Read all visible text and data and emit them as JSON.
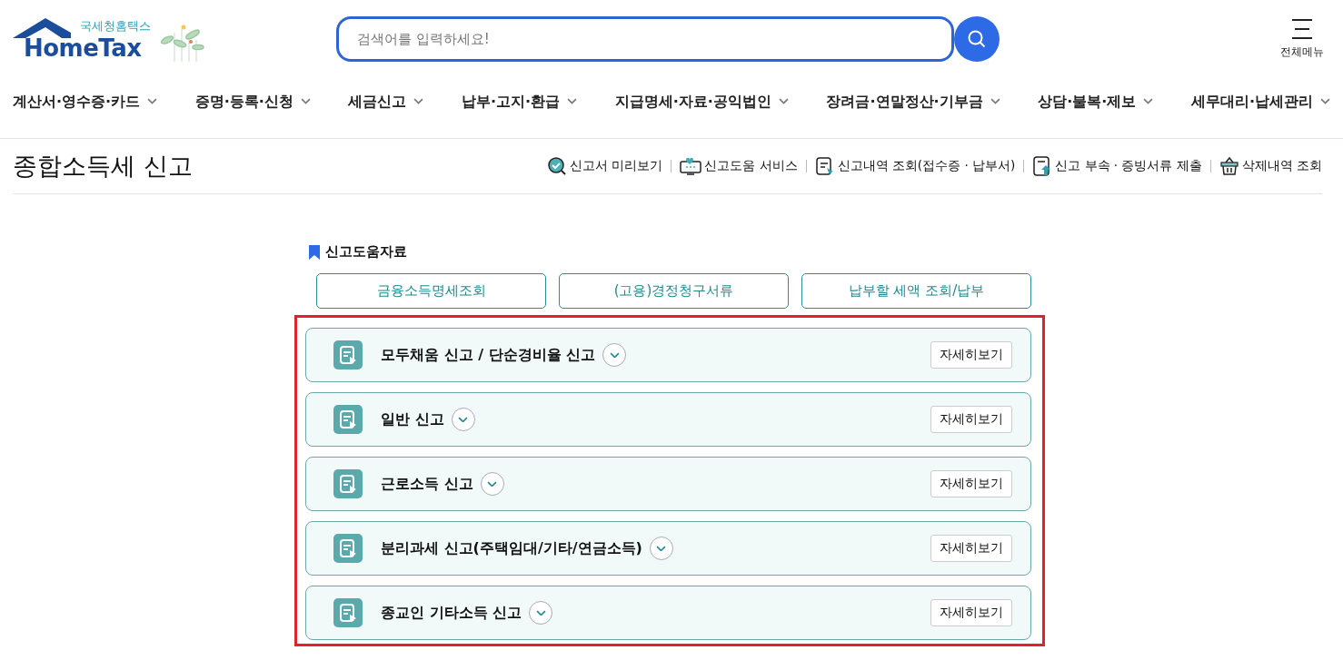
{
  "header": {
    "logo": {
      "subtitle": "국세청홈택스",
      "name": "HomeTax"
    },
    "search": {
      "placeholder": "검색어를 입력하세요!"
    },
    "all_menu": "전체메뉴"
  },
  "nav": [
    {
      "label": "계산서·영수증·카드"
    },
    {
      "label": "증명·등록·신청"
    },
    {
      "label": "세금신고"
    },
    {
      "label": "납부·고지·환급"
    },
    {
      "label": "지급명세·자료·공익법인"
    },
    {
      "label": "장려금·연말정산·기부금"
    },
    {
      "label": "상담·불복·제보"
    },
    {
      "label": "세무대리·납세관리"
    }
  ],
  "page": {
    "title": "종합소득세 신고",
    "links": [
      {
        "kind": "preview",
        "label": "신고서 미리보기"
      },
      {
        "kind": "help",
        "label": "신고도움 서비스"
      },
      {
        "kind": "history",
        "label": "신고내역 조회(접수증 · 납부서)"
      },
      {
        "kind": "upload",
        "label": "신고 부속 · 증빙서류 제출"
      },
      {
        "kind": "trash",
        "label": "삭제내역 조회"
      }
    ]
  },
  "help_section": {
    "title": "신고도움자료",
    "buttons": [
      "금융소득명세조회",
      "(고용)경정청구서류",
      "납부할 세액 조회/납부"
    ]
  },
  "filing_types": [
    {
      "label": "모두채움 신고 / 단순경비율 신고",
      "expanded": false,
      "detail_button": "자세히보기"
    },
    {
      "label": "일반 신고",
      "expanded": false,
      "detail_button": "자세히보기"
    },
    {
      "label": "근로소득 신고",
      "expanded": false,
      "detail_button": "자세히보기"
    },
    {
      "label": "분리과세 신고(주택임대/기타/연금소득)",
      "expanded": false,
      "detail_button": "자세히보기"
    },
    {
      "label": "종교인 기타소득 신고",
      "expanded": false,
      "detail_button": "자세히보기"
    }
  ]
}
